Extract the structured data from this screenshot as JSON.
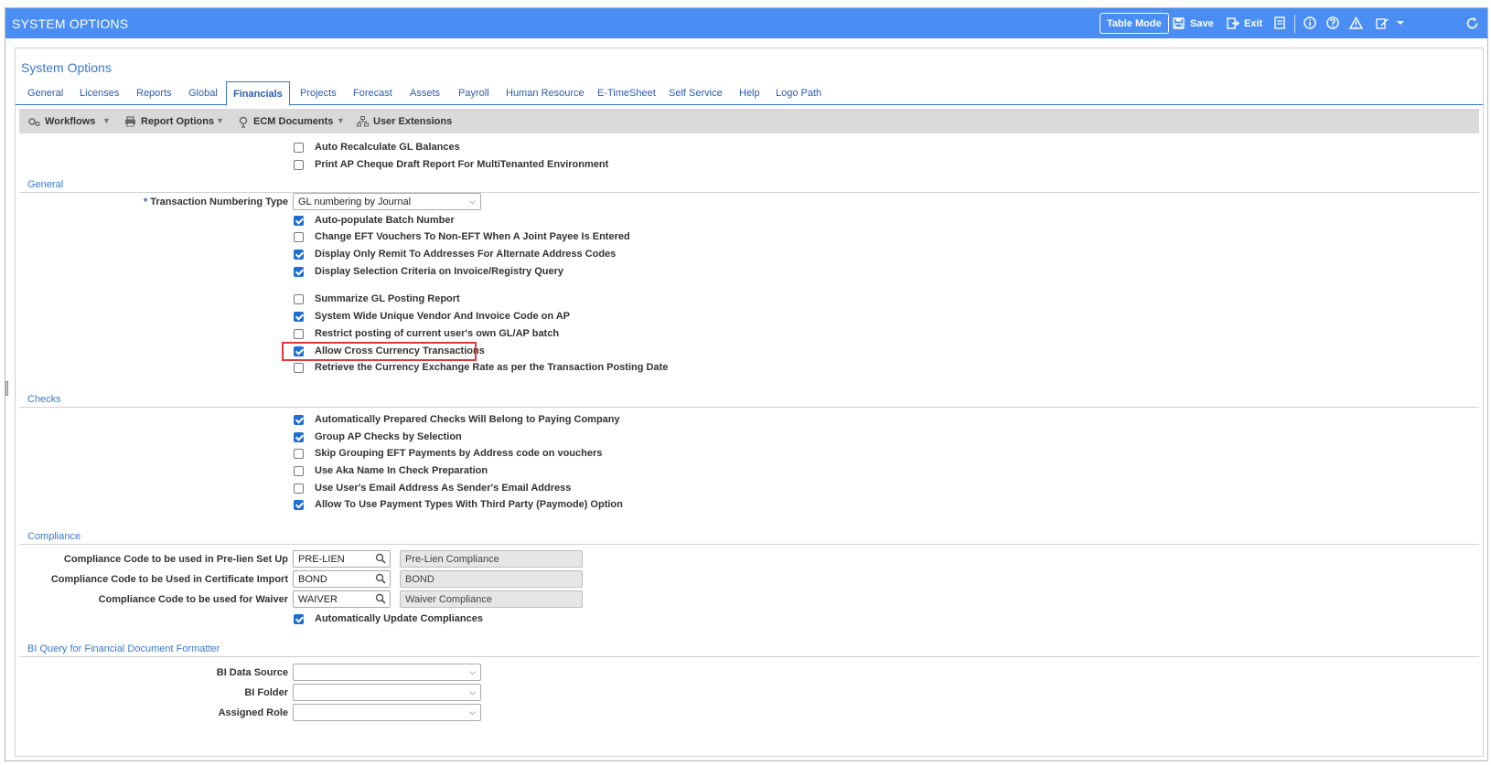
{
  "header": {
    "title": "SYSTEM OPTIONS",
    "table_mode": "Table Mode",
    "save": "Save",
    "exit": "Exit"
  },
  "panel": {
    "title": "System Options"
  },
  "tabs": [
    "General",
    "Licenses",
    "Reports",
    "Global",
    "Financials",
    "Projects",
    "Forecast",
    "Assets",
    "Payroll",
    "Human Resource",
    "E-TimeSheet",
    "Self Service",
    "Help",
    "Logo Path"
  ],
  "active_tab": "Financials",
  "toolbar": {
    "workflows": "Workflows",
    "report_options": "Report Options",
    "ecm_documents": "ECM Documents",
    "user_extensions": "User Extensions"
  },
  "top_options": [
    {
      "label": "Auto Recalculate GL Balances",
      "checked": false
    },
    {
      "label": "Print AP Cheque Draft Report For MultiTenanted Environment",
      "checked": false
    }
  ],
  "general": {
    "section": "General",
    "transaction_numbering_label": "Transaction Numbering Type",
    "transaction_numbering_value": "GL numbering by Journal",
    "options": [
      {
        "label": "Auto-populate Batch Number",
        "checked": true
      },
      {
        "label": "Change EFT Vouchers To Non-EFT When A Joint Payee Is Entered",
        "checked": false
      },
      {
        "label": "Display Only Remit To Addresses For Alternate Address Codes",
        "checked": true
      },
      {
        "label": "Display Selection Criteria on Invoice/Registry Query",
        "checked": true
      },
      {
        "label": "Summarize GL Posting Report",
        "checked": false
      },
      {
        "label": "System Wide Unique Vendor And Invoice Code on AP",
        "checked": true
      },
      {
        "label": "Restrict posting of current user's own GL/AP batch",
        "checked": false
      },
      {
        "label": "Allow Cross Currency Transactions",
        "checked": true
      },
      {
        "label": "Retrieve the Currency Exchange Rate as per the Transaction Posting Date",
        "checked": false
      }
    ]
  },
  "checks": {
    "section": "Checks",
    "options": [
      {
        "label": "Automatically Prepared Checks Will Belong to Paying Company",
        "checked": true
      },
      {
        "label": "Group AP Checks by Selection",
        "checked": true
      },
      {
        "label": "Skip Grouping EFT Payments by Address code on vouchers",
        "checked": false
      },
      {
        "label": "Use Aka Name In Check Preparation",
        "checked": false
      },
      {
        "label": "Use User's Email Address As Sender's Email Address",
        "checked": false
      },
      {
        "label": "Allow To Use Payment Types With Third Party (Paymode) Option",
        "checked": true
      }
    ]
  },
  "compliance": {
    "section": "Compliance",
    "fields": [
      {
        "label": "Compliance Code to be used in Pre-lien Set Up",
        "code": "PRE-LIEN",
        "description": "Pre-Lien Compliance"
      },
      {
        "label": "Compliance Code to be Used in Certificate Import",
        "code": "BOND",
        "description": "BOND"
      },
      {
        "label": "Compliance Code to be used for Waiver",
        "code": "WAIVER",
        "description": "Waiver Compliance"
      }
    ],
    "auto_update": {
      "label": "Automatically Update Compliances",
      "checked": true
    }
  },
  "bi": {
    "section": "BI Query for Financial Document Formatter",
    "data_source_label": "BI Data Source",
    "folder_label": "BI Folder",
    "assigned_role_label": "Assigned Role",
    "data_source_value": "",
    "folder_value": "",
    "assigned_role_value": ""
  },
  "colors": {
    "header": "#4a8ef4",
    "accent": "#3a78c9",
    "checkbox": "#1f6fd1",
    "highlight": "#e0383a"
  }
}
